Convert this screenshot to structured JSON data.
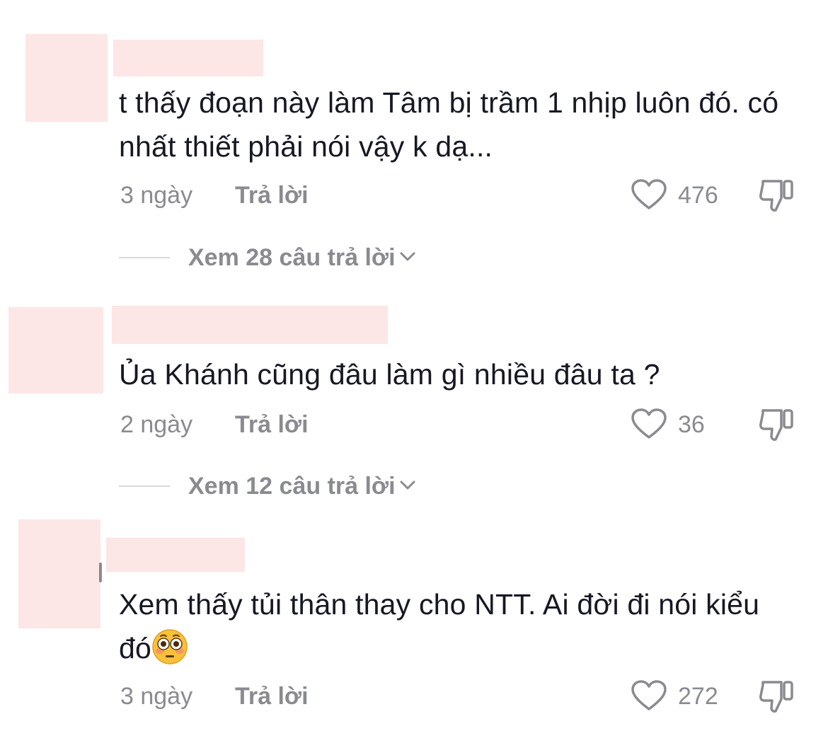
{
  "comments": [
    {
      "text": "t thấy đoạn này làm Tâm bị trầm 1 nhịp luôn đó. có nhất thiết phải nói vậy k dạ...",
      "time": "3 ngày",
      "reply_label": "Trả lời",
      "likes": "476",
      "view_replies": "Xem 28 câu trả lời"
    },
    {
      "text": "Ủa Khánh cũng đâu làm gì nhiều đâu ta ?",
      "time": "2 ngày",
      "reply_label": "Trả lời",
      "likes": "36",
      "view_replies": "Xem 12 câu trả lời"
    },
    {
      "text": "Xem thấy tủi thân thay cho NTT. Ai đời đi nói kiểu đó",
      "emoji": "flushed-face-icon",
      "time": "3 ngày",
      "reply_label": "Trả lời",
      "likes": "272"
    }
  ],
  "colors": {
    "redaction": "#fde6e6",
    "text": "#161823",
    "secondary": "#8a8b91"
  }
}
